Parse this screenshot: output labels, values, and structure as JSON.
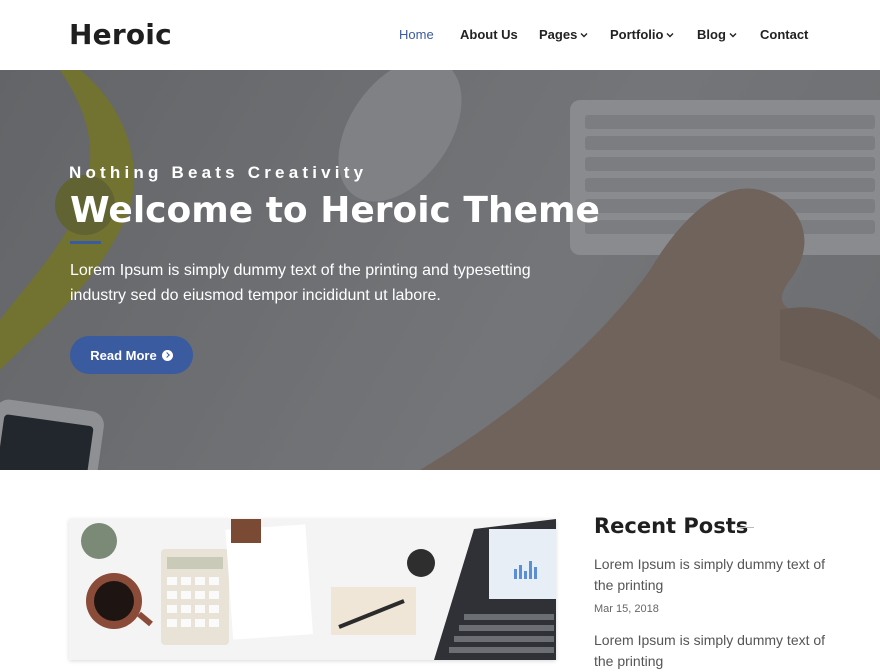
{
  "header": {
    "logo": "Heroic",
    "nav": [
      {
        "label": "Home",
        "active": true
      },
      {
        "label": "About Us"
      },
      {
        "label": "Pages",
        "dropdown": true
      },
      {
        "label": "Portfolio",
        "dropdown": true
      },
      {
        "label": "Blog",
        "dropdown": true
      },
      {
        "label": "Contact"
      }
    ]
  },
  "hero": {
    "tagline": "Nothing Beats Creativity",
    "title": "Welcome to Heroic Theme",
    "description": "Lorem Ipsum is simply dummy text of the printing and typesetting industry sed do eiusmod tempor incididunt ut labore.",
    "button_label": "Read More"
  },
  "sidebar": {
    "title": "Recent Posts",
    "posts": [
      {
        "title": "Lorem Ipsum is simply dummy text of the printing",
        "date": "Mar 15, 2018"
      },
      {
        "title": "Lorem Ipsum is simply dummy text of the printing"
      }
    ]
  },
  "colors": {
    "accent": "#3a5ba0",
    "text_dark": "#1f1f1f"
  }
}
